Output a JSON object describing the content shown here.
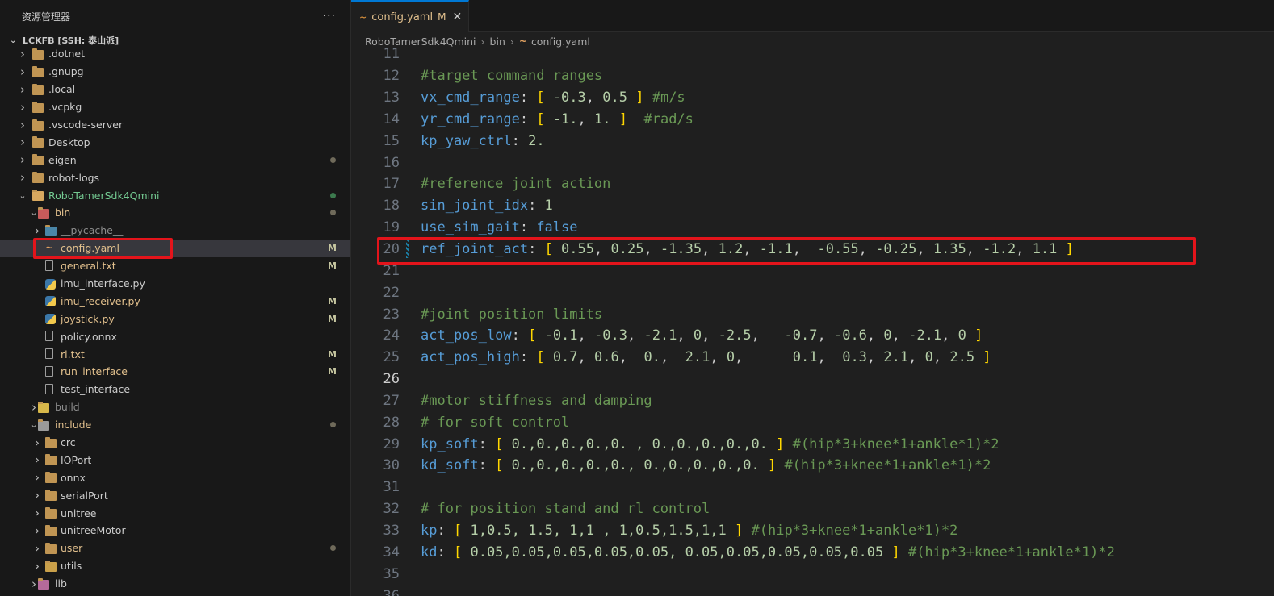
{
  "sidebar": {
    "title": "资源管理器",
    "more": "···",
    "root_label": "LCKFB [SSH: 泰山派]",
    "items": [
      {
        "label": ".dotnet",
        "type": "folder",
        "depth": 0,
        "expanded": false,
        "badge": "",
        "dot": ""
      },
      {
        "label": ".gnupg",
        "type": "folder",
        "depth": 0,
        "expanded": false,
        "badge": "",
        "dot": ""
      },
      {
        "label": ".local",
        "type": "folder",
        "depth": 0,
        "expanded": false,
        "badge": "",
        "dot": ""
      },
      {
        "label": ".vcpkg",
        "type": "folder",
        "depth": 0,
        "expanded": false,
        "badge": "",
        "dot": ""
      },
      {
        "label": ".vscode-server",
        "type": "folder",
        "depth": 0,
        "expanded": false,
        "badge": "",
        "dot": ""
      },
      {
        "label": "Desktop",
        "type": "folder",
        "depth": 0,
        "expanded": false,
        "badge": "",
        "dot": ""
      },
      {
        "label": "eigen",
        "type": "folder",
        "depth": 0,
        "expanded": false,
        "badge": "",
        "dot": "gray"
      },
      {
        "label": "robot-logs",
        "type": "folder",
        "depth": 0,
        "expanded": false,
        "badge": "",
        "dot": ""
      },
      {
        "label": "RoboTamerSdk4Qmini",
        "type": "folder",
        "depth": 0,
        "expanded": true,
        "badge": "",
        "dot": "green",
        "color": "#73c991"
      },
      {
        "label": "bin",
        "type": "folder-bin",
        "depth": 1,
        "expanded": true,
        "badge": "",
        "dot": "gray",
        "color": "#e2c08d"
      },
      {
        "label": "__pycache__",
        "type": "folder-py",
        "depth": 2,
        "expanded": false,
        "badge": "",
        "dot": "",
        "color": "#8c8c8c"
      },
      {
        "label": "config.yaml",
        "type": "yaml",
        "depth": 2,
        "badge": "M",
        "dot": "",
        "color": "#e2c08d",
        "selected": true
      },
      {
        "label": "general.txt",
        "type": "file",
        "depth": 2,
        "badge": "M",
        "dot": "",
        "color": "#e2c08d"
      },
      {
        "label": "imu_interface.py",
        "type": "py",
        "depth": 2,
        "badge": "",
        "dot": ""
      },
      {
        "label": "imu_receiver.py",
        "type": "py",
        "depth": 2,
        "badge": "M",
        "dot": "",
        "color": "#e2c08d"
      },
      {
        "label": "joystick.py",
        "type": "py",
        "depth": 2,
        "badge": "M",
        "dot": "",
        "color": "#e2c08d"
      },
      {
        "label": "policy.onnx",
        "type": "file",
        "depth": 2,
        "badge": "",
        "dot": ""
      },
      {
        "label": "rl.txt",
        "type": "file",
        "depth": 2,
        "badge": "M",
        "dot": "",
        "color": "#e2c08d"
      },
      {
        "label": "run_interface",
        "type": "file",
        "depth": 2,
        "badge": "M",
        "dot": "",
        "color": "#e2c08d"
      },
      {
        "label": "test_interface",
        "type": "file",
        "depth": 2,
        "badge": "",
        "dot": ""
      },
      {
        "label": "build",
        "type": "folder-build",
        "depth": 1,
        "expanded": false,
        "badge": "",
        "dot": "",
        "color": "#8c8c8c"
      },
      {
        "label": "include",
        "type": "folder-inc",
        "depth": 1,
        "expanded": true,
        "badge": "",
        "dot": "gray",
        "color": "#e2c08d"
      },
      {
        "label": "crc",
        "type": "folder",
        "depth": 2,
        "expanded": false,
        "badge": "",
        "dot": ""
      },
      {
        "label": "IOPort",
        "type": "folder",
        "depth": 2,
        "expanded": false,
        "badge": "",
        "dot": ""
      },
      {
        "label": "onnx",
        "type": "folder",
        "depth": 2,
        "expanded": false,
        "badge": "",
        "dot": ""
      },
      {
        "label": "serialPort",
        "type": "folder",
        "depth": 2,
        "expanded": false,
        "badge": "",
        "dot": ""
      },
      {
        "label": "unitree",
        "type": "folder",
        "depth": 2,
        "expanded": false,
        "badge": "",
        "dot": ""
      },
      {
        "label": "unitreeMotor",
        "type": "folder",
        "depth": 2,
        "expanded": false,
        "badge": "",
        "dot": ""
      },
      {
        "label": "user",
        "type": "folder",
        "depth": 2,
        "expanded": false,
        "badge": "",
        "dot": "gray",
        "color": "#e2c08d"
      },
      {
        "label": "utils",
        "type": "folder-utils",
        "depth": 2,
        "expanded": false,
        "badge": "",
        "dot": ""
      },
      {
        "label": "lib",
        "type": "folder-lib",
        "depth": 1,
        "expanded": false,
        "badge": "",
        "dot": ""
      }
    ]
  },
  "editor": {
    "tab": {
      "label": "config.yaml",
      "modified": "M",
      "close": "✕"
    },
    "breadcrumb": [
      "RoboTamerSdk4Qmini",
      "bin",
      "config.yaml"
    ],
    "current_line": 26,
    "lines": [
      {
        "n": "11",
        "tokens": []
      },
      {
        "n": "12",
        "tokens": [
          [
            "cm",
            "#target command ranges"
          ]
        ]
      },
      {
        "n": "13",
        "tokens": [
          [
            "key",
            "vx_cmd_range"
          ],
          [
            "p",
            ": "
          ],
          [
            "br",
            "["
          ],
          [
            "p",
            " "
          ],
          [
            "num",
            "-0.3"
          ],
          [
            "p",
            ", "
          ],
          [
            "num",
            "0.5"
          ],
          [
            "p",
            " "
          ],
          [
            "br",
            "]"
          ],
          [
            "p",
            " "
          ],
          [
            "cm",
            "#m/s"
          ]
        ]
      },
      {
        "n": "14",
        "tokens": [
          [
            "key",
            "yr_cmd_range"
          ],
          [
            "p",
            ": "
          ],
          [
            "br",
            "["
          ],
          [
            "p",
            " "
          ],
          [
            "num",
            "-1."
          ],
          [
            "p",
            ", "
          ],
          [
            "num",
            "1."
          ],
          [
            "p",
            " "
          ],
          [
            "br",
            "]"
          ],
          [
            "p",
            "  "
          ],
          [
            "cm",
            "#rad/s"
          ]
        ]
      },
      {
        "n": "15",
        "tokens": [
          [
            "key",
            "kp_yaw_ctrl"
          ],
          [
            "p",
            ": "
          ],
          [
            "num",
            "2."
          ]
        ]
      },
      {
        "n": "16",
        "tokens": []
      },
      {
        "n": "17",
        "tokens": [
          [
            "cm",
            "#reference joint action"
          ]
        ]
      },
      {
        "n": "18",
        "tokens": [
          [
            "key",
            "sin_joint_idx"
          ],
          [
            "p",
            ": "
          ],
          [
            "num",
            "1"
          ]
        ]
      },
      {
        "n": "19",
        "tokens": [
          [
            "key",
            "use_sim_gait"
          ],
          [
            "p",
            ": "
          ],
          [
            "kw",
            "false"
          ]
        ]
      },
      {
        "n": "20",
        "git": true,
        "tokens": [
          [
            "key",
            "ref_joint_act"
          ],
          [
            "p",
            ": "
          ],
          [
            "br",
            "["
          ],
          [
            "p",
            " "
          ],
          [
            "num",
            "0.55"
          ],
          [
            "p",
            ", "
          ],
          [
            "num",
            "0.25"
          ],
          [
            "p",
            ", "
          ],
          [
            "num",
            "-1.35"
          ],
          [
            "p",
            ", "
          ],
          [
            "num",
            "1.2"
          ],
          [
            "p",
            ", "
          ],
          [
            "num",
            "-1.1"
          ],
          [
            "p",
            ",  "
          ],
          [
            "num",
            "-0.55"
          ],
          [
            "p",
            ", "
          ],
          [
            "num",
            "-0.25"
          ],
          [
            "p",
            ", "
          ],
          [
            "num",
            "1.35"
          ],
          [
            "p",
            ", "
          ],
          [
            "num",
            "-1.2"
          ],
          [
            "p",
            ", "
          ],
          [
            "num",
            "1.1"
          ],
          [
            "p",
            " "
          ],
          [
            "br",
            "]"
          ]
        ]
      },
      {
        "n": "21",
        "tokens": []
      },
      {
        "n": "22",
        "tokens": []
      },
      {
        "n": "23",
        "tokens": [
          [
            "cm",
            "#joint position limits"
          ]
        ]
      },
      {
        "n": "24",
        "tokens": [
          [
            "key",
            "act_pos_low"
          ],
          [
            "p",
            ": "
          ],
          [
            "br",
            "["
          ],
          [
            "p",
            " "
          ],
          [
            "num",
            "-0.1"
          ],
          [
            "p",
            ", "
          ],
          [
            "num",
            "-0.3"
          ],
          [
            "p",
            ", "
          ],
          [
            "num",
            "-2.1"
          ],
          [
            "p",
            ", "
          ],
          [
            "num",
            "0"
          ],
          [
            "p",
            ", "
          ],
          [
            "num",
            "-2.5"
          ],
          [
            "p",
            ",   "
          ],
          [
            "num",
            "-0.7"
          ],
          [
            "p",
            ", "
          ],
          [
            "num",
            "-0.6"
          ],
          [
            "p",
            ", "
          ],
          [
            "num",
            "0"
          ],
          [
            "p",
            ", "
          ],
          [
            "num",
            "-2.1"
          ],
          [
            "p",
            ", "
          ],
          [
            "num",
            "0"
          ],
          [
            "p",
            " "
          ],
          [
            "br",
            "]"
          ]
        ]
      },
      {
        "n": "25",
        "tokens": [
          [
            "key",
            "act_pos_high"
          ],
          [
            "p",
            ": "
          ],
          [
            "br",
            "["
          ],
          [
            "p",
            " "
          ],
          [
            "num",
            "0.7"
          ],
          [
            "p",
            ", "
          ],
          [
            "num",
            "0.6"
          ],
          [
            "p",
            ",  "
          ],
          [
            "num",
            "0."
          ],
          [
            "p",
            ",  "
          ],
          [
            "num",
            "2.1"
          ],
          [
            "p",
            ", "
          ],
          [
            "num",
            "0"
          ],
          [
            "p",
            ",      "
          ],
          [
            "num",
            "0.1"
          ],
          [
            "p",
            ",  "
          ],
          [
            "num",
            "0.3"
          ],
          [
            "p",
            ", "
          ],
          [
            "num",
            "2.1"
          ],
          [
            "p",
            ", "
          ],
          [
            "num",
            "0"
          ],
          [
            "p",
            ", "
          ],
          [
            "num",
            "2.5"
          ],
          [
            "p",
            " "
          ],
          [
            "br",
            "]"
          ]
        ]
      },
      {
        "n": "26",
        "tokens": []
      },
      {
        "n": "27",
        "tokens": [
          [
            "cm",
            "#motor stiffness and damping"
          ]
        ]
      },
      {
        "n": "28",
        "tokens": [
          [
            "cm",
            "# for soft control"
          ]
        ]
      },
      {
        "n": "29",
        "tokens": [
          [
            "key",
            "kp_soft"
          ],
          [
            "p",
            ": "
          ],
          [
            "br",
            "["
          ],
          [
            "p",
            " "
          ],
          [
            "num",
            "0.,0.,0.,0.,0. , 0.,0.,0.,0.,0."
          ],
          [
            "p",
            " "
          ],
          [
            "br",
            "]"
          ],
          [
            "p",
            " "
          ],
          [
            "cm",
            "#(hip*3+knee*1+ankle*1)*2"
          ]
        ]
      },
      {
        "n": "30",
        "tokens": [
          [
            "key",
            "kd_soft"
          ],
          [
            "p",
            ": "
          ],
          [
            "br",
            "["
          ],
          [
            "p",
            " "
          ],
          [
            "num",
            "0.,0.,0.,0.,0., 0.,0.,0.,0.,0."
          ],
          [
            "p",
            " "
          ],
          [
            "br",
            "]"
          ],
          [
            "p",
            " "
          ],
          [
            "cm",
            "#(hip*3+knee*1+ankle*1)*2"
          ]
        ]
      },
      {
        "n": "31",
        "tokens": []
      },
      {
        "n": "32",
        "tokens": [
          [
            "cm",
            "# for position stand and rl control"
          ]
        ]
      },
      {
        "n": "33",
        "tokens": [
          [
            "key",
            "kp"
          ],
          [
            "p",
            ": "
          ],
          [
            "br",
            "["
          ],
          [
            "p",
            " "
          ],
          [
            "num",
            "1,0.5, 1.5, 1,1 , 1,0.5,1.5,1,1"
          ],
          [
            "p",
            " "
          ],
          [
            "br",
            "]"
          ],
          [
            "p",
            " "
          ],
          [
            "cm",
            "#(hip*3+knee*1+ankle*1)*2"
          ]
        ]
      },
      {
        "n": "34",
        "tokens": [
          [
            "key",
            "kd"
          ],
          [
            "p",
            ": "
          ],
          [
            "br",
            "["
          ],
          [
            "p",
            " "
          ],
          [
            "num",
            "0.05,0.05,0.05,0.05,0.05, 0.05,0.05,0.05,0.05,0.05"
          ],
          [
            "p",
            " "
          ],
          [
            "br",
            "]"
          ],
          [
            "p",
            " "
          ],
          [
            "cm",
            "#(hip*3+knee*1+ankle*1)*2"
          ]
        ]
      },
      {
        "n": "35",
        "tokens": []
      },
      {
        "n": "36",
        "tokens": []
      }
    ]
  },
  "colors": {
    "accent": "#0078d4",
    "highlight": "#e3141b",
    "modified": "#e2c08d",
    "added": "#73c991"
  }
}
